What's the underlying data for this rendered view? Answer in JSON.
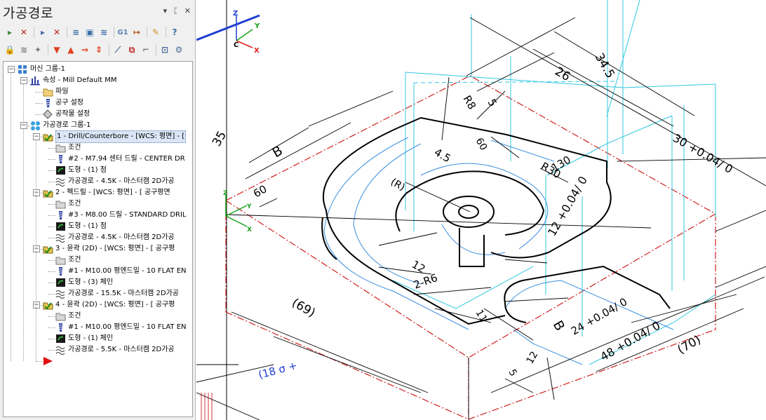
{
  "panel": {
    "title": "가공경로",
    "controls": [
      "▾",
      "ᛈ",
      "✕"
    ],
    "toolbar_row1": [
      {
        "icon": "select-all-ops-icon",
        "glyph": "▸",
        "color": "#3a8a3a"
      },
      {
        "icon": "deselect-ops-icon",
        "glyph": "✕",
        "color": "#c02020"
      },
      {
        "icon": "regen-selected-icon",
        "glyph": "▸",
        "color": "#4b6fb0"
      },
      {
        "icon": "regen-dirty-icon",
        "glyph": "✕",
        "color": "#c02020"
      },
      {
        "icon": "backplot-icon",
        "glyph": "≋",
        "color": "#3a6ea8"
      },
      {
        "icon": "verify-icon",
        "glyph": "▣",
        "color": "#3a6ea8"
      },
      {
        "icon": "simulate-icon",
        "glyph": "≋",
        "color": "#3a6ea8"
      },
      {
        "icon": "post-selected-icon",
        "glyph": "G1",
        "color": "#5a7fb5"
      },
      {
        "icon": "highfeed-icon",
        "glyph": "↦",
        "color": "#b05a20"
      },
      {
        "icon": "delete-ops-icon",
        "glyph": "✎",
        "color": "#c89020"
      },
      {
        "icon": "help-icon",
        "glyph": "?",
        "color": "#3a6ea8"
      }
    ],
    "toolbar_row2": [
      {
        "icon": "lock-icon",
        "glyph": "🔒",
        "color": "#d4a020"
      },
      {
        "icon": "toggle-display-icon",
        "glyph": "≋",
        "color": "#7a7a7a"
      },
      {
        "icon": "toggle-post-icon",
        "glyph": "✦",
        "color": "#7a7a7a"
      },
      {
        "icon": "move-down-icon",
        "glyph": "▼",
        "color": "#e04020"
      },
      {
        "icon": "move-up-icon",
        "glyph": "▲",
        "color": "#e04020"
      },
      {
        "icon": "insert-arrow-icon",
        "glyph": "⇒",
        "color": "#e04020"
      },
      {
        "icon": "scroll-icon",
        "glyph": "⇕",
        "color": "#e04020"
      },
      {
        "icon": "expand-icon",
        "glyph": "⟋",
        "color": "#4a6a9a"
      },
      {
        "icon": "collapse-icon",
        "glyph": "⧉",
        "color": "#c04040"
      },
      {
        "icon": "view-icon",
        "glyph": "⌐",
        "color": "#7a7a7a"
      },
      {
        "icon": "stock-icon",
        "glyph": "⊡",
        "color": "#4a6a9a"
      },
      {
        "icon": "options-icon",
        "glyph": "⚙",
        "color": "#4a6a9a"
      }
    ],
    "tree": [
      {
        "lvl": 0,
        "exp": "−",
        "icon": "machine-group-icon",
        "label": "머신 그룹-1"
      },
      {
        "lvl": 1,
        "exp": "−",
        "icon": "properties-icon",
        "label": "속성 - Mill Default MM"
      },
      {
        "lvl": 2,
        "icon": "folder-icon",
        "label": "파일"
      },
      {
        "lvl": 2,
        "icon": "tool-setup-icon",
        "label": "공구 설정"
      },
      {
        "lvl": 2,
        "icon": "stock-setup-icon",
        "label": "공작물 설정"
      },
      {
        "lvl": 1,
        "exp": "−",
        "icon": "toolpath-group-icon",
        "label": "가공경로 그룹-1"
      },
      {
        "lvl": 2,
        "exp": "−",
        "icon": "operation-folder-icon",
        "label": "1 - Drill/Counterbore - [WCS: 평면] - [",
        "sel": true
      },
      {
        "lvl": 3,
        "icon": "parameters-icon",
        "label": "조건"
      },
      {
        "lvl": 3,
        "icon": "tool-icon",
        "label": "#2 - M7.94 센터 드릴 - CENTER DR"
      },
      {
        "lvl": 3,
        "icon": "geometry-icon",
        "label": "도형 - (1) 점"
      },
      {
        "lvl": 3,
        "icon": "toolpath-icon",
        "label": "가공경로 - 4.5K - 마스터캠 2D가공"
      },
      {
        "lvl": 2,
        "exp": "−",
        "icon": "operation-folder-icon",
        "label": "2 - 펙드릴 - [WCS: 평면] - [  공구평면"
      },
      {
        "lvl": 3,
        "icon": "parameters-icon",
        "label": "조건"
      },
      {
        "lvl": 3,
        "icon": "tool-icon",
        "label": "#3 - M8.00 드릴 - STANDARD DRIL"
      },
      {
        "lvl": 3,
        "icon": "geometry-icon",
        "label": "도형 - (1) 점"
      },
      {
        "lvl": 3,
        "icon": "toolpath-icon",
        "label": "가공경로 - 4.5K - 마스터캠 2D가공"
      },
      {
        "lvl": 2,
        "exp": "−",
        "icon": "operation-folder-icon",
        "label": "3 - 윤곽 (2D) - [WCS: 평면] - [  공구평"
      },
      {
        "lvl": 3,
        "icon": "parameters-icon",
        "label": "조건"
      },
      {
        "lvl": 3,
        "icon": "tool-icon",
        "label": "#1 - M10.00 평엔드밀 - 10 FLAT EN"
      },
      {
        "lvl": 3,
        "icon": "geometry-icon",
        "label": "도형 - (3) 체인"
      },
      {
        "lvl": 3,
        "icon": "toolpath-icon",
        "label": "가공경로 - 15.5K - 마스터캠 2D가공"
      },
      {
        "lvl": 2,
        "exp": "−",
        "icon": "operation-folder-icon",
        "label": "4 - 윤곽 (2D) - [WCS: 평면] - [  공구평"
      },
      {
        "lvl": 3,
        "icon": "parameters-icon",
        "label": "조건"
      },
      {
        "lvl": 3,
        "icon": "tool-icon",
        "label": "#1 - M10.00 평엔드밀 - 10 FLAT EN"
      },
      {
        "lvl": 3,
        "icon": "geometry-icon",
        "label": "도형 - (1) 체인"
      },
      {
        "lvl": 3,
        "icon": "toolpath-icon",
        "label": "가공경로 - 5.5K - 마스터캠 2D가공"
      },
      {
        "lvl": 2,
        "icon": "insert-arrow-icon",
        "label": ""
      }
    ]
  },
  "viewport": {
    "axis_labels": {
      "x": "X",
      "y": "Y",
      "z": "Z",
      "c": "C"
    },
    "dimensions": [
      "34.5",
      "26",
      "R8",
      "5",
      "4.5",
      "60",
      "B",
      "35",
      "(R)",
      "R30",
      "130",
      "30 +0.04/ 0",
      "60",
      "12 +0.04/ 0",
      "12",
      "2-R6",
      "(69)",
      "11",
      "B",
      "24 +0.04/ 0",
      "12",
      "48 +0.04/ 0",
      "5",
      "(70)",
      "(18  σ  +"
    ],
    "colors": {
      "axis_x": "#e02020",
      "axis_y": "#19a019",
      "axis_z": "#1f3fd0",
      "wire_blue": "#3a8fe0",
      "wire_cyan": "#30c8e0",
      "hidden_red": "#d02020"
    }
  }
}
